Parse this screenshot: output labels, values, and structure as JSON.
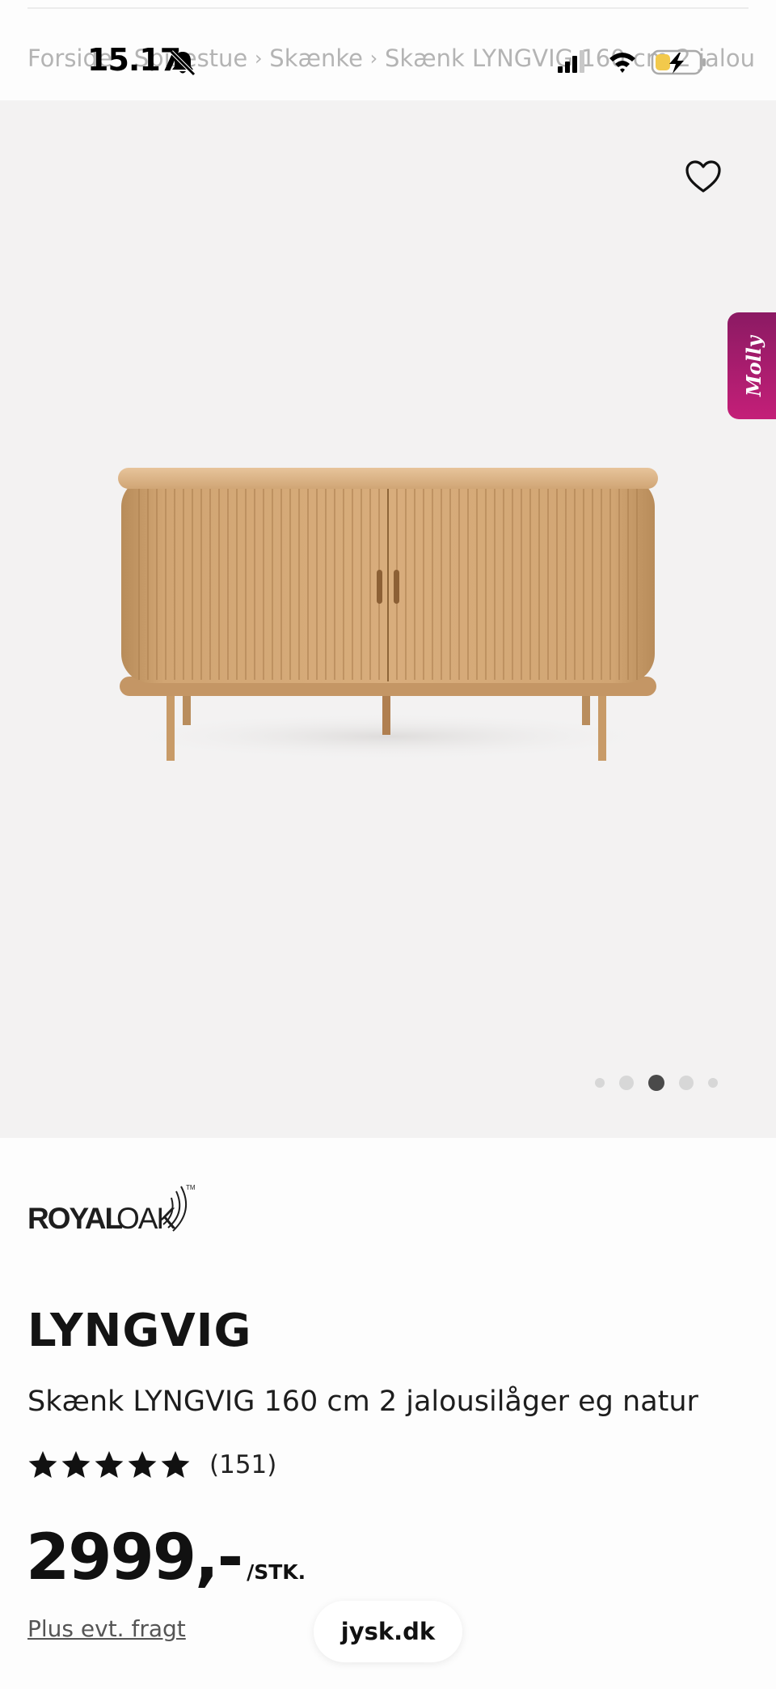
{
  "status_bar": {
    "time": "15.17",
    "battery_level": 0.35
  },
  "breadcrumb": {
    "items": [
      "Forside",
      "Spisestue",
      "Skænke",
      "Skænk LYNGVIG 160 cm 2 jalou"
    ],
    "separator": "›"
  },
  "gallery": {
    "favorite_icon": "heart-outline-icon",
    "image_count": 5,
    "active_index": 2
  },
  "chat_widget": {
    "label": "Molly",
    "color": "#b01e70"
  },
  "product": {
    "brand": "ROYALOAK",
    "name": "LYNGVIG",
    "description": "Skænk LYNGVIG 160 cm 2 jalousilåger eg natur",
    "rating_stars": 5,
    "rating_count": "(151)",
    "price": "2999,-",
    "price_unit": "/STK.",
    "shipping_note": "Plus evt. fragt"
  },
  "browser": {
    "url": "jysk.dk"
  }
}
